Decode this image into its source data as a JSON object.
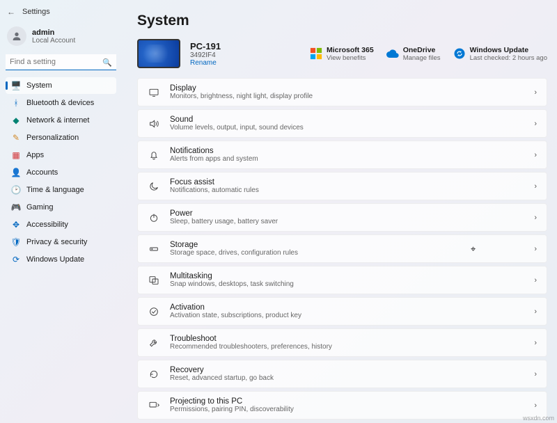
{
  "titlebar": {
    "label": "Settings"
  },
  "user": {
    "name": "admin",
    "sub": "Local Account"
  },
  "search": {
    "placeholder": "Find a setting"
  },
  "nav": [
    {
      "label": "System",
      "icon": "🖥️",
      "color": "c-blue",
      "sel": true
    },
    {
      "label": "Bluetooth & devices",
      "icon": "ᚼ",
      "color": "c-blue"
    },
    {
      "label": "Network & internet",
      "icon": "◆",
      "color": "c-teal"
    },
    {
      "label": "Personalization",
      "icon": "✎",
      "color": "c-orange"
    },
    {
      "label": "Apps",
      "icon": "▦",
      "color": "c-red"
    },
    {
      "label": "Accounts",
      "icon": "👤",
      "color": "c-orange"
    },
    {
      "label": "Time & language",
      "icon": "🕑",
      "color": "c-blue"
    },
    {
      "label": "Gaming",
      "icon": "🎮",
      "color": "c-green"
    },
    {
      "label": "Accessibility",
      "icon": "✥",
      "color": "c-blue"
    },
    {
      "label": "Privacy & security",
      "icon": "🛡",
      "color": "c-blue"
    },
    {
      "label": "Windows Update",
      "icon": "⟳",
      "color": "c-blue"
    }
  ],
  "page": {
    "title": "System"
  },
  "pc": {
    "name": "PC-191",
    "id": "3492IF4",
    "rename": "Rename"
  },
  "heroLinks": [
    {
      "title": "Microsoft 365",
      "sub": "View benefits",
      "icon": "ms365"
    },
    {
      "title": "OneDrive",
      "sub": "Manage files",
      "icon": "cloud"
    },
    {
      "title": "Windows Update",
      "sub": "Last checked: 2 hours ago",
      "icon": "sync"
    }
  ],
  "rows": [
    {
      "title": "Display",
      "sub": "Monitors, brightness, night light, display profile",
      "icon": "display"
    },
    {
      "title": "Sound",
      "sub": "Volume levels, output, input, sound devices",
      "icon": "sound"
    },
    {
      "title": "Notifications",
      "sub": "Alerts from apps and system",
      "icon": "bell"
    },
    {
      "title": "Focus assist",
      "sub": "Notifications, automatic rules",
      "icon": "moon"
    },
    {
      "title": "Power",
      "sub": "Sleep, battery usage, battery saver",
      "icon": "power"
    },
    {
      "title": "Storage",
      "sub": "Storage space, drives, configuration rules",
      "icon": "storage"
    },
    {
      "title": "Multitasking",
      "sub": "Snap windows, desktops, task switching",
      "icon": "multitask"
    },
    {
      "title": "Activation",
      "sub": "Activation state, subscriptions, product key",
      "icon": "check"
    },
    {
      "title": "Troubleshoot",
      "sub": "Recommended troubleshooters, preferences, history",
      "icon": "wrench"
    },
    {
      "title": "Recovery",
      "sub": "Reset, advanced startup, go back",
      "icon": "recovery"
    },
    {
      "title": "Projecting to this PC",
      "sub": "Permissions, pairing PIN, discoverability",
      "icon": "project"
    }
  ],
  "watermark": "wsxdn.com"
}
